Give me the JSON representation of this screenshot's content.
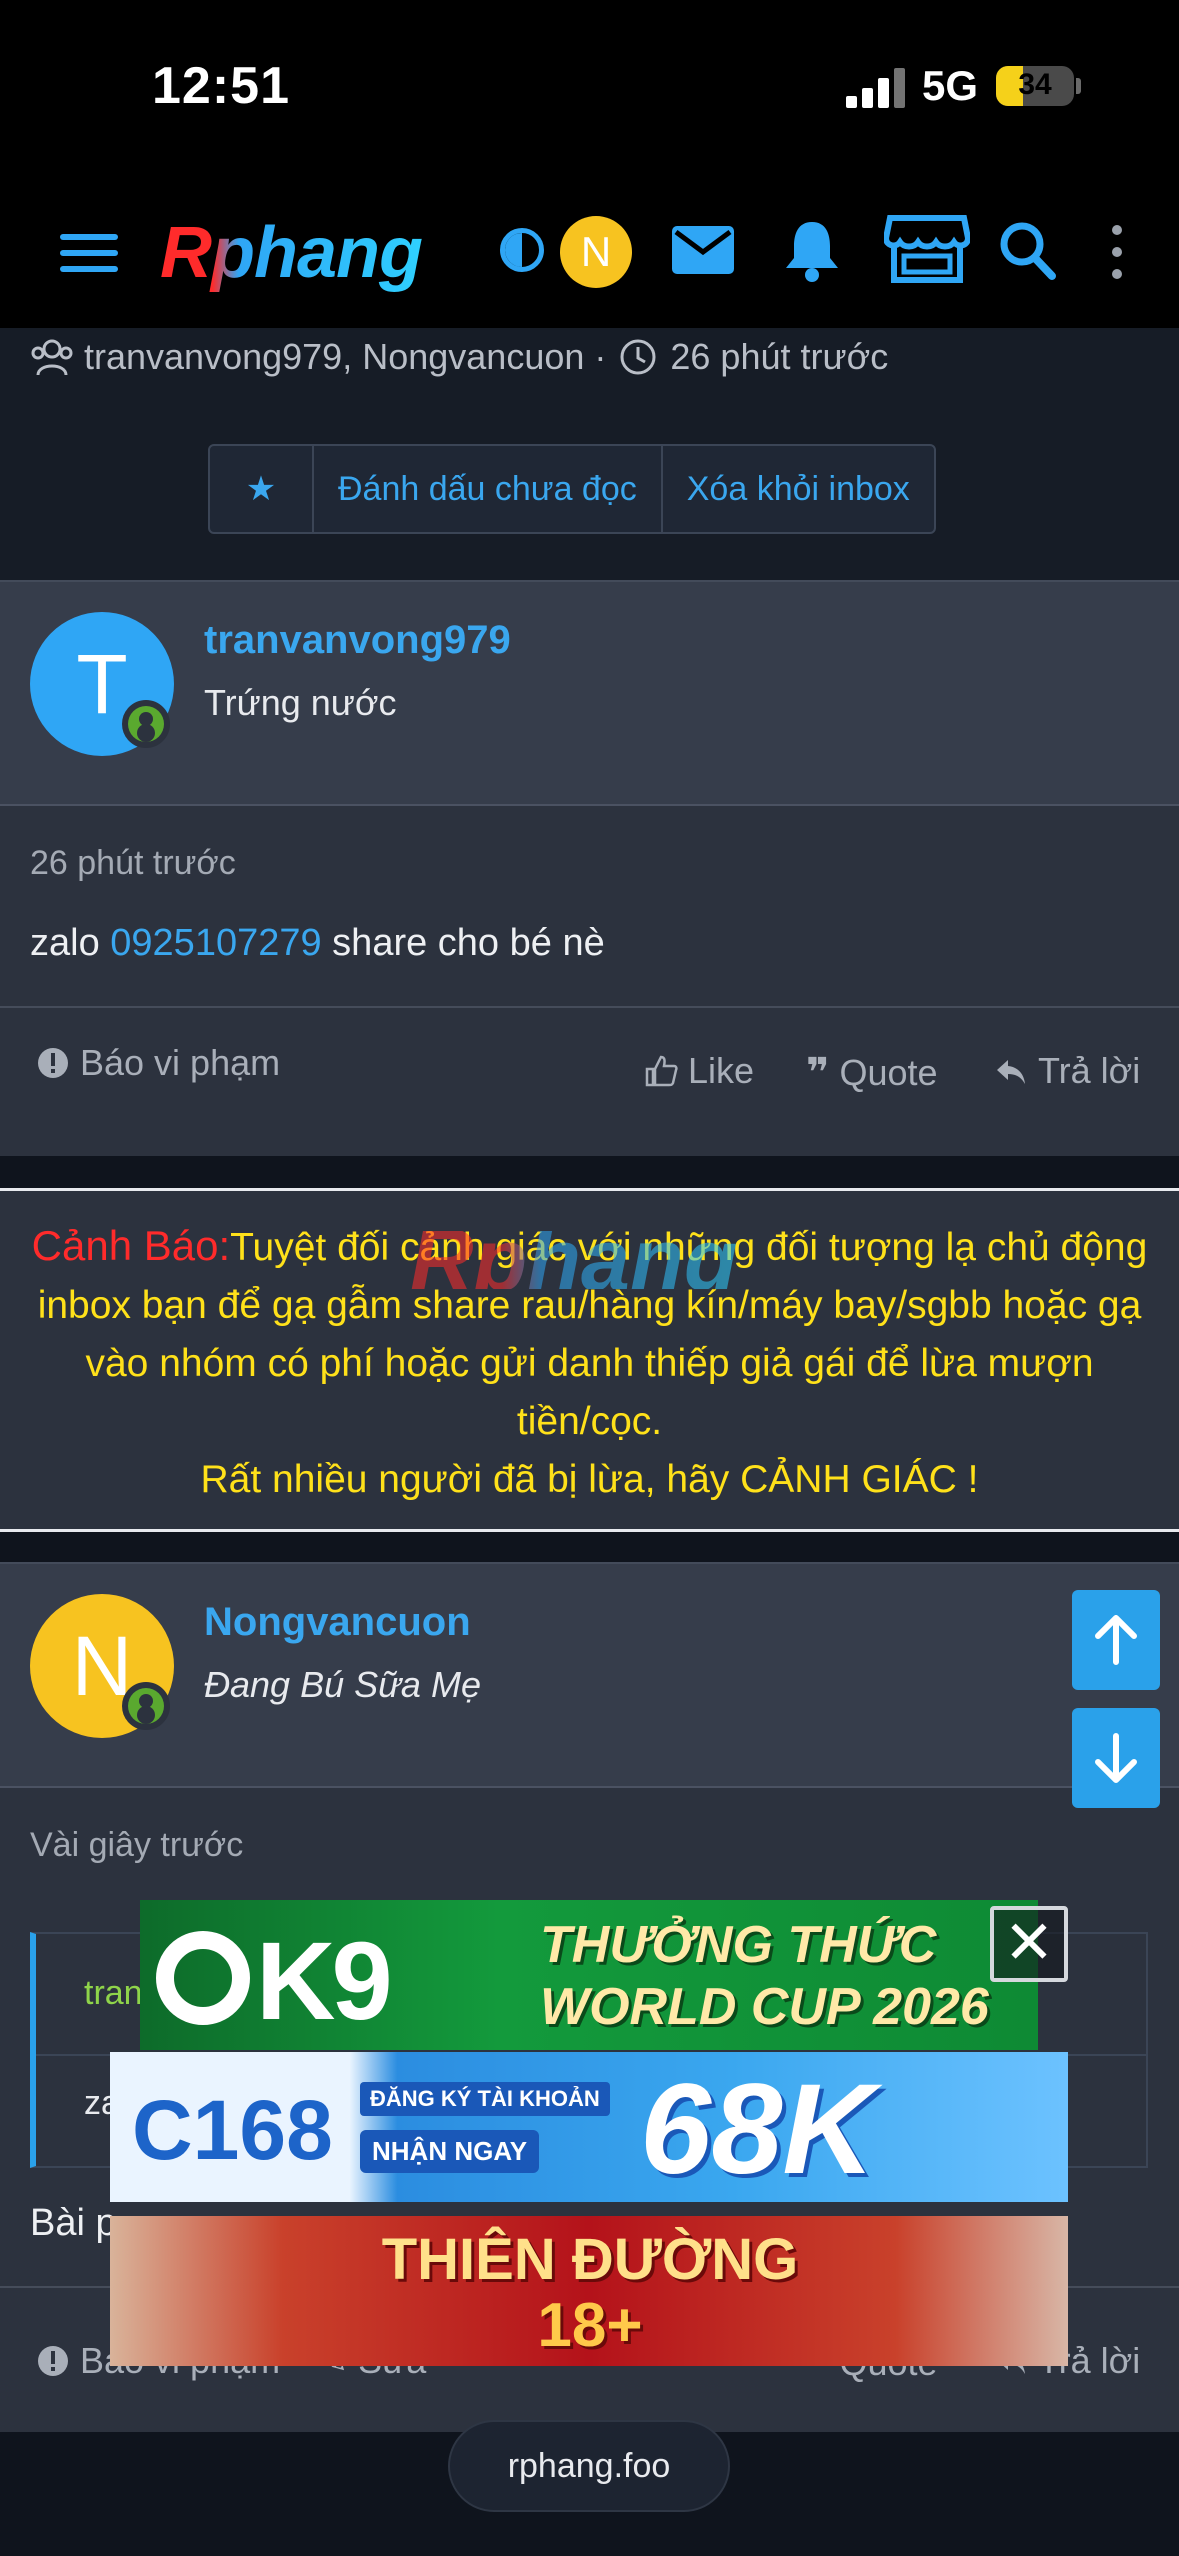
{
  "status_bar": {
    "time": "12:51",
    "network": "5G",
    "battery": "34",
    "battery_level": 0.34
  },
  "header": {
    "logo": "Rphang",
    "avatar_letter": "N"
  },
  "thread": {
    "participants": "tranvanvong979, Nongvancuon",
    "time": "26 phút trước",
    "separator": "·"
  },
  "actions": {
    "mark_unread": "Đánh dấu chưa đọc",
    "remove_inbox": "Xóa khỏi inbox"
  },
  "messages": [
    {
      "avatar_letter": "T",
      "avatar_color": "#2fa6f5",
      "username": "tranvanvong979",
      "user_title": "Trứng nước",
      "time": "26 phút trước",
      "text_prefix": "zalo ",
      "phone": "0925107279",
      "text_suffix": " share cho bé nè",
      "report": "Báo vi phạm",
      "like": "Like",
      "quote": "Quote",
      "reply": "Trả lời"
    },
    {
      "avatar_letter": "N",
      "avatar_color": "#f7c320",
      "username": "Nongvancuon",
      "user_title": "Đang Bú Sữa Mẹ",
      "time": "Vài giây trước",
      "quote_author_partial": "tran",
      "quote_text_partial": "za",
      "text_partial": "Bài p",
      "report_partial": "Báo vi phạm",
      "edit_partial": "Sửa",
      "quote": "Quote",
      "reply": "Trả lời"
    }
  ],
  "warning": {
    "label": "Cảnh Báo:",
    "text": "Tuyệt đối cảnh giác với những đối tượng lạ chủ động inbox bạn để gạ gẫm share rau/hàng kín/máy bay/sgbb hoặc gạ vào nhóm có phí hoặc gửi danh thiếp giả gái để lừa mượn tiền/cọc.",
    "line2": "Rất nhiều người đã bị lừa, hãy CẢNH GIÁC !",
    "watermark": "Rphang"
  },
  "ads": {
    "ad1_brand": "K9",
    "ad1_line1": "THƯỞNG THỨC",
    "ad1_line2": "WORLD CUP 2026",
    "ad2_brand": "C168",
    "ad2_sub1": "ĐĂNG KÝ TÀI KHOẢN",
    "ad2_sub2": "NHẬN NGAY",
    "ad2_big": "68K",
    "ad3_line1": "THIÊN ĐƯỜNG",
    "ad3_line2": "18+",
    "close": "✕"
  },
  "browser": {
    "url": "rphang.foo"
  },
  "colors": {
    "accent": "#2fa6f5",
    "warning_yellow": "#ffe11a",
    "warning_red": "#ff2b2b",
    "online": "#5aa92f"
  }
}
